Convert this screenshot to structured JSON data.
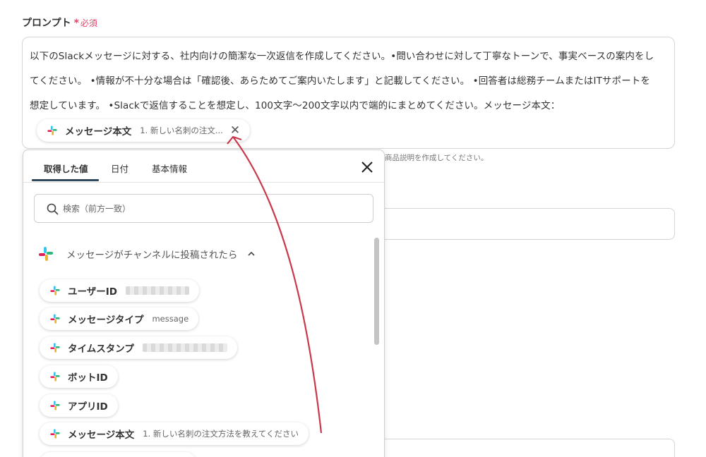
{
  "field": {
    "label": "プロンプト",
    "required_star": "*",
    "required_text": "必須"
  },
  "prompt": {
    "text": "以下のSlackメッセージに対する、社内向けの簡潔な一次返信を作成してください。•問い合わせに対して丁寧なトーンで、事実ベースの案内をしてください。 •情報が不十分な場合は「確認後、あらためてご案内いたします」と記載してください。 •回答者は総務チームまたはITサポートを想定しています。 •Slackで返信することを想定し、100文字〜200文字以内で端的にまとめてください。メッセージ本文："
  },
  "inserted_token": {
    "label": "メッセージ本文",
    "value": "1. 新しい名刺の注文...",
    "close": "✕"
  },
  "background": {
    "hint": "商品説明を作成してください。"
  },
  "popup": {
    "tabs": [
      {
        "label": "取得した値",
        "active": true
      },
      {
        "label": "日付",
        "active": false
      },
      {
        "label": "基本情報",
        "active": false
      }
    ],
    "search_placeholder": "検索（前方一致）",
    "group_title": "メッセージがチャンネルに投稿されたら",
    "items": [
      {
        "label": "ユーザーID",
        "value": ""
      },
      {
        "label": "メッセージタイプ",
        "value": "message"
      },
      {
        "label": "タイムスタンプ",
        "value": ""
      },
      {
        "label": "ボットID",
        "value": ""
      },
      {
        "label": "アプリID",
        "value": ""
      },
      {
        "label": "メッセージ本文",
        "value": "1. 新しい名刺の注文方法を教えてください"
      }
    ]
  },
  "colors": {
    "required": "#e0476b",
    "arrow": "#c9394b",
    "tab_underline": "#2f4a5e"
  },
  "icons": {
    "token_icon": "slack-icon",
    "search": "search-icon",
    "close": "close-icon",
    "group": "chevron-up-icon"
  }
}
